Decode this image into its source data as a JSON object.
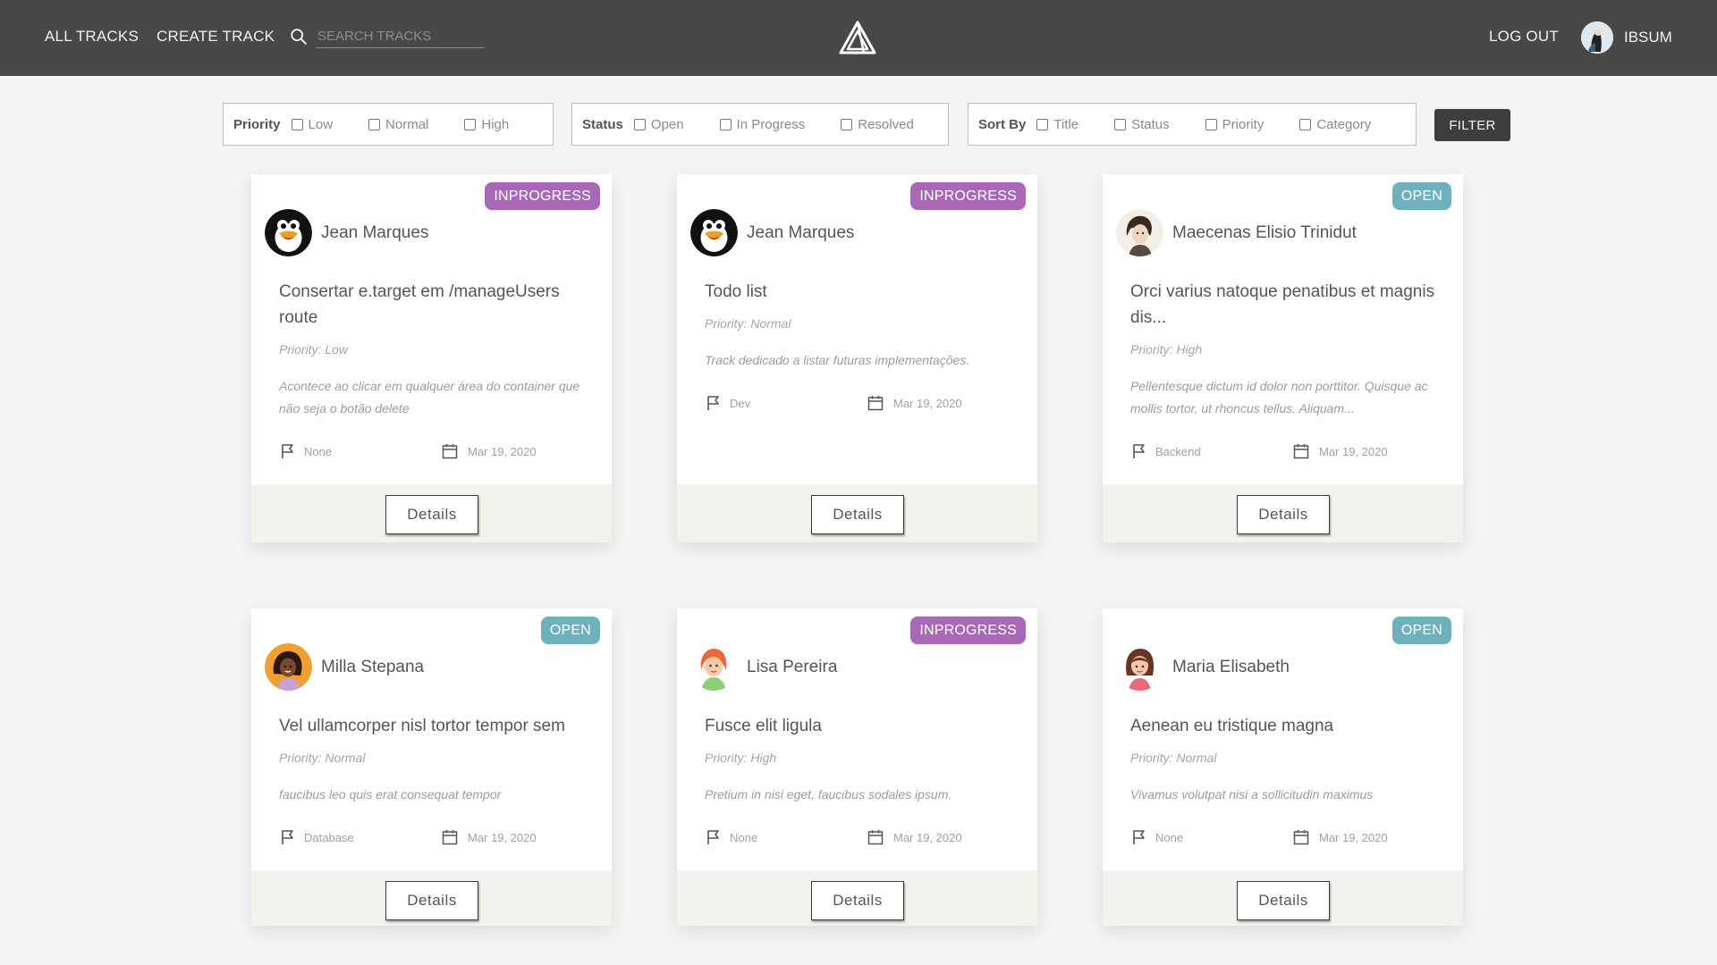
{
  "nav": {
    "all_tracks": "ALL TRACKS",
    "create_track": "CREATE TRACK",
    "search_placeholder": "SEARCH TRACKS",
    "logout": "LOG OUT",
    "username": "IBSUM"
  },
  "filters": {
    "priority": {
      "label": "Priority",
      "options": [
        "Low",
        "Normal",
        "High"
      ]
    },
    "status": {
      "label": "Status",
      "options": [
        "Open",
        "In Progress",
        "Resolved"
      ]
    },
    "sort": {
      "label": "Sort By",
      "options": [
        "Title",
        "Status",
        "Priority",
        "Category"
      ]
    },
    "button": "FILTER"
  },
  "colors": {
    "inprogress": "#a868b6",
    "open": "#6fb0bd",
    "topbar": "#484848"
  },
  "cards": [
    {
      "status": "INPROGRESS",
      "author": "Jean Marques",
      "avatar": "penguin-avatar",
      "title": "Consertar e.target em /manageUsers route",
      "priority": "Priority: Low",
      "description": "Acontece ao clicar em qualquer área do container que não seja o botão delete",
      "category": "None",
      "date": "Mar 19, 2020",
      "button": "Details"
    },
    {
      "status": "INPROGRESS",
      "author": "Jean Marques",
      "avatar": "penguin-avatar",
      "title": "Todo list",
      "priority": "Priority: Normal",
      "description": "Track dedicado a listar futuras implementações.",
      "category": "Dev",
      "date": "Mar 19, 2020",
      "button": "Details"
    },
    {
      "status": "OPEN",
      "author": "Maecenas Elisio Trinidut",
      "avatar": "sketch-portrait-avatar",
      "title": "Orci varius natoque penatibus et magnis dis...",
      "priority": "Priority: High",
      "description": "Pellentesque dictum id dolor non porttitor. Quisque ac mollis tortor, ut rhoncus tellus. Aliquam...",
      "category": "Backend",
      "date": "Mar 19, 2020",
      "button": "Details"
    },
    {
      "status": "OPEN",
      "author": "Milla Stepana",
      "avatar": "cartoon-woman-avatar",
      "title": "Vel ullamcorper nisl tortor tempor sem",
      "priority": "Priority: Normal",
      "description": "faucibus leo quis erat consequat tempor",
      "category": "Database",
      "date": "Mar 19, 2020",
      "button": "Details"
    },
    {
      "status": "INPROGRESS",
      "author": "Lisa Pereira",
      "avatar": "redhead-avatar",
      "title": "Fusce elit ligula",
      "priority": "Priority: High",
      "description": "Pretium in nisi eget, faucibus sodales ipsum.",
      "category": "None",
      "date": "Mar 19, 2020",
      "button": "Details"
    },
    {
      "status": "OPEN",
      "author": "Maria Elisabeth",
      "avatar": "brunette-avatar",
      "title": "Aenean eu tristique magna",
      "priority": "Priority: Normal",
      "description": "Vivamus volutpat nisi a sollicitudin maximus",
      "category": "None",
      "date": "Mar 19, 2020",
      "button": "Details"
    }
  ]
}
